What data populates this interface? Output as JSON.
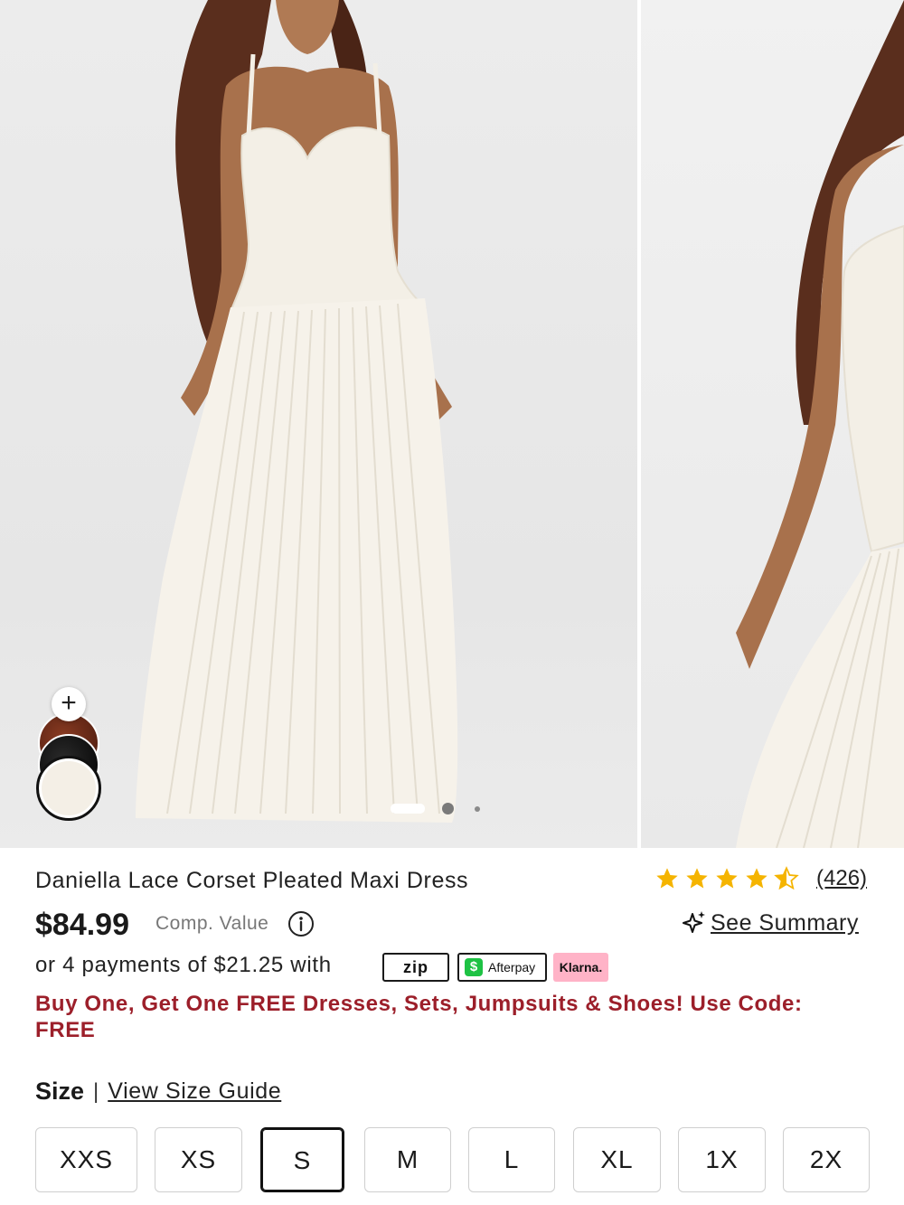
{
  "product": {
    "title": "Daniella Lace Corset Pleated Maxi Dress",
    "price": "$84.99",
    "comp_value_label": "Comp. Value",
    "rating": 4.5,
    "review_count": "(426)",
    "summary_label": "See Summary"
  },
  "payments": {
    "text": "or 4 payments of $21.25 with",
    "zip_label": "zip",
    "afterpay_label": "Afterpay",
    "cash_app_symbol": "$",
    "klarna_label": "Klarna."
  },
  "promo": {
    "text": "Buy One, Get One FREE Dresses, Sets, Jumpsuits & Shoes! Use Code: FREE"
  },
  "colors": {
    "add_symbol": "+",
    "swatches": [
      "brown",
      "black",
      "white"
    ],
    "selected": "white"
  },
  "carousel": {
    "slide_count": 3,
    "active_index": 0
  },
  "size": {
    "label": "Size",
    "separator": "|",
    "guide_label": "View Size Guide",
    "options": [
      "XXS",
      "XS",
      "S",
      "M",
      "L",
      "XL",
      "1X",
      "2X"
    ],
    "selected": "S"
  },
  "theme": {
    "promo_color": "#9c1f2a",
    "star_color": "#f5b400",
    "klarna_pink": "#ffb3c7",
    "cash_app_green": "#1ec244"
  },
  "icons": [
    "plus-icon",
    "share-icon",
    "info-icon",
    "sparkle-icon",
    "star-icon",
    "cash-app-icon"
  ]
}
